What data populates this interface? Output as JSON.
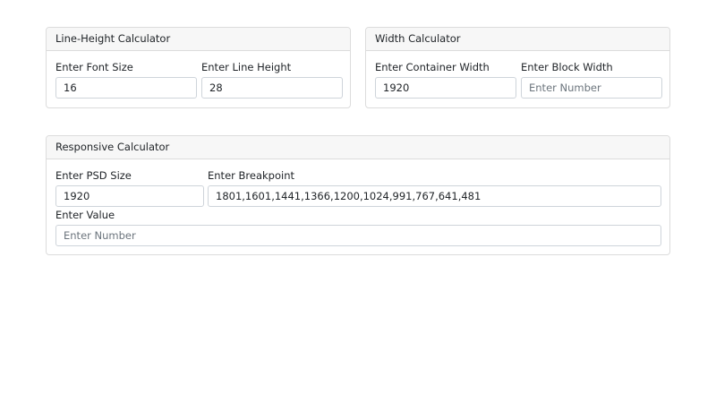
{
  "line_height_calculator": {
    "title": "Line-Height Calculator",
    "font_size_label": "Enter Font Size",
    "font_size_value": "16",
    "line_height_label": "Enter Line Height",
    "line_height_value": "28"
  },
  "width_calculator": {
    "title": "Width Calculator",
    "container_width_label": "Enter Container Width",
    "container_width_value": "1920",
    "block_width_label": "Enter Block Width",
    "block_width_placeholder": "Enter Number",
    "block_width_value": ""
  },
  "responsive_calculator": {
    "title": "Responsive Calculator",
    "psd_size_label": "Enter PSD Size",
    "psd_size_value": "1920",
    "breakpoint_label": "Enter Breakpoint",
    "breakpoint_value": "1801,1601,1441,1366,1200,1024,991,767,641,481",
    "value_label": "Enter Value",
    "value_placeholder": "Enter Number",
    "value_value": ""
  }
}
